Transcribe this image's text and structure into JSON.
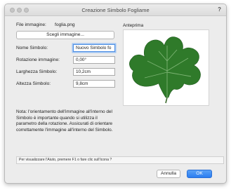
{
  "window": {
    "title": "Creazione Simbolo Fogliame",
    "help_glyph": "?"
  },
  "file": {
    "label": "File immagine:",
    "value": "foglia.png"
  },
  "choose_button": {
    "label": "Scegli immagine..."
  },
  "fields": [
    {
      "label": "Nome Simbolo:",
      "value": "Nuovo Simbolo fo"
    },
    {
      "label": "Rotazione immagine:",
      "value": "0,00°"
    },
    {
      "label": "Larghezza Simbolo:",
      "value": "10,2cm"
    },
    {
      "label": "Altezza Simbolo:",
      "value": "9,8cm"
    }
  ],
  "note": "Nota: l'orientamento dell'immagine all'interno del Simbolo è importante quando si utilizza il parametro della rotazione. Assicurati di orientare correttamente l'immagine all'interno del Simbolo.",
  "preview": {
    "label": "Anteprima",
    "image": "fig-leaf"
  },
  "hint": "Per visualizzare l'Aiuto, premere F1 o fare clic sull'icona ?",
  "buttons": {
    "cancel": "Annulla",
    "ok": "OK"
  },
  "colors": {
    "accent": "#2b7df0",
    "leaf": "#2f7a2a"
  }
}
